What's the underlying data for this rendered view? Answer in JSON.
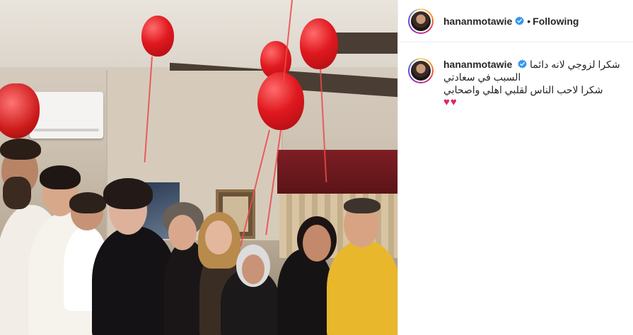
{
  "post": {
    "username": "hananmotawie",
    "separator": "•",
    "follow_status": "Following",
    "caption_lines": [
      "شكرا لزوجي لانه دائما",
      "السبب في سعادتي",
      "شكرا لاحب الناس لقلبي اهلي واصحابي"
    ],
    "caption_emoji": "♥♥"
  },
  "colors": {
    "verified_badge": "#3897f0",
    "heart": "#e0245e",
    "balloon": "#e0191f"
  },
  "icons": {
    "verified": "verified-badge-icon",
    "heart": "red-heart-emoji"
  }
}
